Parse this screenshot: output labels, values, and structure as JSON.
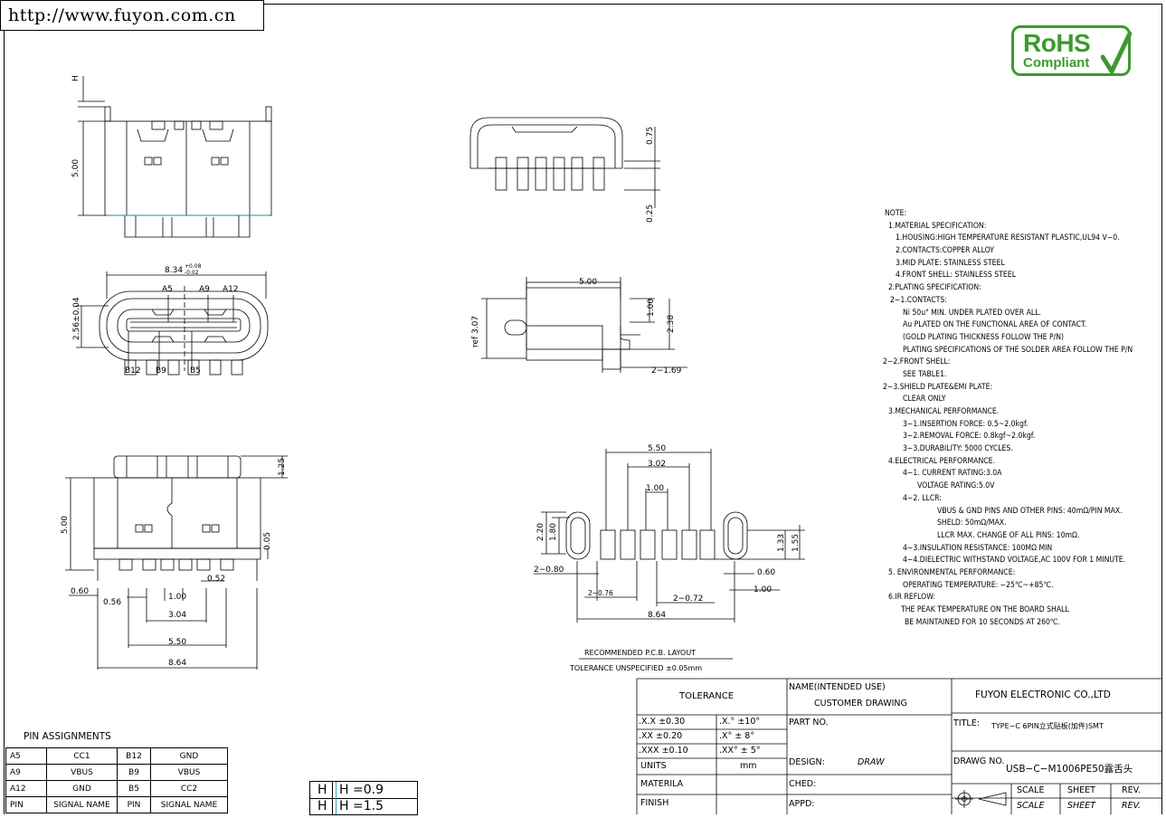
{
  "header": {
    "url": "http://www.fuyon.com.cn"
  },
  "logo": {
    "line1": "RoHS",
    "line2": "Compliant",
    "color": "#3d9a2f"
  },
  "dimensions": {
    "front_view": {
      "h_mark": "H",
      "height": "5.00"
    },
    "top_right_view": {
      "d1": "0.75",
      "d2": "0.25"
    },
    "opening_view": {
      "width_main": "8.34",
      "tol_up": "+0.08",
      "tol_down": "-0.02",
      "height": "2.56±0.04",
      "top_pins": [
        "A5",
        "A9",
        "A12"
      ],
      "bottom_pins": [
        "B12",
        "B9",
        "B5"
      ]
    },
    "side_view": {
      "w": "5.00",
      "h1": "1.00",
      "h2": "2.38",
      "ref": "ref 3.07",
      "pitch": "2−1.69"
    },
    "bottom_view": {
      "height": "5.00",
      "top_h": "1.25",
      "side_h": "0.05",
      "d060": "0.60",
      "d056": "0.56",
      "d052": "0.52",
      "d100": "1.00",
      "d304": "3.04",
      "d550": "5.50",
      "d864": "8.64"
    },
    "pcb": {
      "w550": "5.50",
      "w302": "3.02",
      "w100": "1.00",
      "h220": "2.20",
      "h180": "1.80",
      "h133": "1.33",
      "h155": "1.55",
      "left080": "2−0.80",
      "d060": "0.60",
      "d100": "1.00",
      "d076": "2−0.76",
      "d072": "2−0.72",
      "d864": "8.64",
      "title": "RECOMMENDED  P.C.B. LAYOUT",
      "tolerance": "TOLERANCE UNSPECIFIED ±0.05mm"
    }
  },
  "notes": [
    "NOTE:",
    "1.MATERIAL SPECIFICATION:",
    "1.HOUSING:HIGH TEMPERATURE RESISTANT PLASTIC,UL94 V−0.",
    "2.CONTACTS:COPPER ALLOY",
    "3.MID PLATE: STAINLESS STEEL",
    "4.FRONT SHELL: STAINLESS STEEL",
    "2.PLATING SPECIFICATION:",
    "2−1.CONTACTS:",
    "Ni 50u\" MIN. UNDER PLATED OVER ALL.",
    "Au PLATED ON THE FUNCTIONAL AREA OF CONTACT.",
    "(GOLD PLATING THICKNESS FOLLOW THE P/N)",
    "PLATING SPECIFICATIONS OF THE SOLDER AREA FOLLOW THE P/N",
    "2−2.FRONT SHELL:",
    "SEE TABLE1.",
    "2−3.SHIELD PLATE&EMI PLATE:",
    "CLEAR ONLY",
    "3.MECHANICAL PERFORMANCE.",
    "3−1.INSERTION FORCE: 0.5~2.0kgf.",
    "3−2.REMOVAL FORCE: 0.8kgf~2.0kgf.",
    "3−3.DURABILITY: 5000 CYCLES.",
    "4.ELECTRICAL PERFORMANCE.",
    "4−1. CURRENT RATING:3.0A",
    "VOLTAGE RATING:5.0V",
    "4−2. LLCR:",
    "VBUS & GND PINS AND OTHER PINS: 40mΩ/PIN MAX.",
    "SHELD: 50mΩ/MAX.",
    "LLCR MAX. CHANGE OF ALL PINS: 10mΩ.",
    "4−3.INSULATION RESISTANCE: 100MΩ  MIN",
    "4−4.DIELECTRIC WITHSTAND VOLTAGE,AC 100V FOR 1 MINUTE.",
    "5. ENVIRONMENTAL PERFORMANCE:",
    "OPERATING TEMPERATURE: −25℃~+85℃.",
    "6.IR REFLOW:",
    "THE PEAK TEMPERATURE ON THE BOARD SHALL",
    "BE MAINTAINED FOR 10 SECONDS AT 260℃."
  ],
  "pin_assignments": {
    "title": "PIN ASSIGNMENTS",
    "rows": [
      [
        "A5",
        "CC1",
        "B12",
        "GND"
      ],
      [
        "A9",
        "VBUS",
        "B9",
        "VBUS"
      ],
      [
        "A12",
        "GND",
        "B5",
        "CC2"
      ],
      [
        "PIN",
        "SIGNAL NAME",
        "PIN",
        "SIGNAL NAME"
      ]
    ]
  },
  "h_table": [
    {
      "a": "H",
      "b": "H   =0.9"
    },
    {
      "a": "H",
      "b": "H   =1.5"
    }
  ],
  "title_block": {
    "tolerance": "TOLERANCE",
    "tol_rows": [
      [
        ".X.X  ±0.30",
        ".X.°  ±10°"
      ],
      [
        ".XX  ±0.20",
        ".X°  ± 8°"
      ],
      [
        ".XXX ±0.10",
        ".XX° ± 5°"
      ]
    ],
    "units_label": "UNITS",
    "units_value": "mm",
    "materila": "MATERILA",
    "finish": "FINISH",
    "name_label": "NAME(INTENDED USE)",
    "name_value": "CUSTOMER DRAWING",
    "part_no": "PART NO.",
    "design_label": "DESIGN:",
    "design_value": "DRAW",
    "ched": "CHED:",
    "appd": "APPD:",
    "company": "FUYON ELECTRONIC CO.,LTD",
    "title_label": "TITLE:",
    "title_value": "TYPE−C 6PIN立式贴板(加件)SMT",
    "drawg_label": "DRAWG NO.",
    "drawg_value": "USB−C−M1006PE50露舌头",
    "scale": "SCALE",
    "sheet": "SHEET",
    "rev": "REV."
  }
}
